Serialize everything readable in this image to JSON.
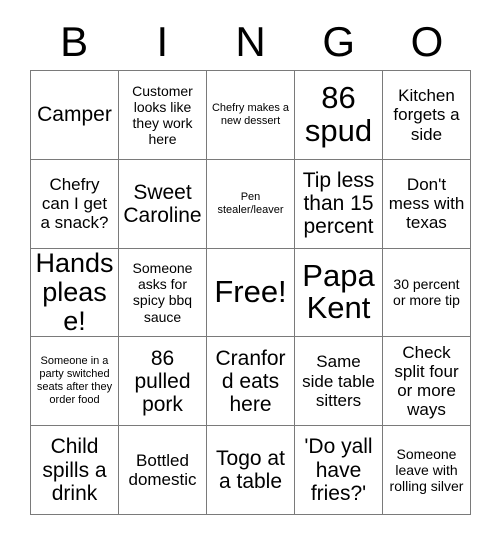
{
  "card": {
    "title": "Bingo Card",
    "header_letters": [
      "B",
      "I",
      "N",
      "G",
      "O"
    ],
    "free_space_label": "Free!",
    "colors": {
      "background": "#ffffff",
      "text": "#000000",
      "grid_line": "#7a7a7a"
    },
    "rows": [
      [
        {
          "text": "Camper",
          "size": "lg"
        },
        {
          "text": "Customer looks like they work here",
          "size": "sm"
        },
        {
          "text": "Chefry makes a new dessert",
          "size": "xs"
        },
        {
          "text": "86 spud",
          "size": "xxl"
        },
        {
          "text": "Kitchen forgets a side",
          "size": "md"
        }
      ],
      [
        {
          "text": "Chefry can I get a snack?",
          "size": "md"
        },
        {
          "text": "Sweet Caroline",
          "size": "lg"
        },
        {
          "text": "Pen stealer/leaver",
          "size": "xs"
        },
        {
          "text": "Tip less than 15 percent",
          "size": "lg"
        },
        {
          "text": "Don't mess with texas",
          "size": "md"
        }
      ],
      [
        {
          "text": "Hands please!",
          "size": "xl"
        },
        {
          "text": "Someone asks for spicy bbq sauce",
          "size": "sm"
        },
        {
          "text": "Free!",
          "size": "xxl"
        },
        {
          "text": "Papa Kent",
          "size": "xxl"
        },
        {
          "text": "30 percent or more tip",
          "size": "sm"
        }
      ],
      [
        {
          "text": "Someone in a party switched seats after they order food",
          "size": "xs"
        },
        {
          "text": "86 pulled pork",
          "size": "lg"
        },
        {
          "text": "Cranford eats here",
          "size": "lg"
        },
        {
          "text": "Same side table sitters",
          "size": "md"
        },
        {
          "text": "Check split four or more ways",
          "size": "md"
        }
      ],
      [
        {
          "text": "Child spills a drink",
          "size": "lg"
        },
        {
          "text": "Bottled domestic",
          "size": "md"
        },
        {
          "text": "Togo at a table",
          "size": "lg"
        },
        {
          "text": "'Do yall have fries?'",
          "size": "lg"
        },
        {
          "text": "Someone leave with rolling silver",
          "size": "sm"
        }
      ]
    ]
  }
}
